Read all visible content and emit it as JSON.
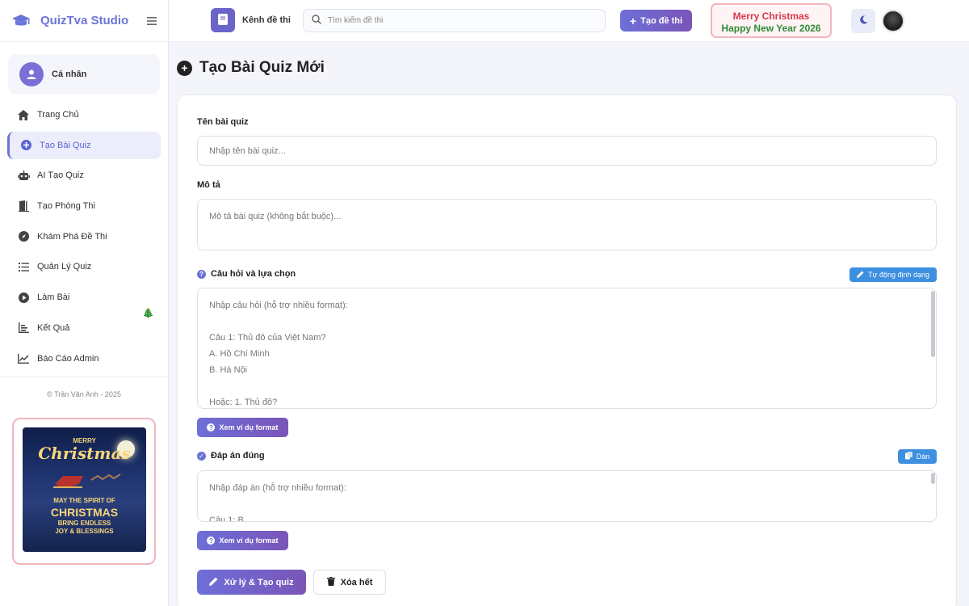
{
  "brand": {
    "name": "QuizTva Studio"
  },
  "sidebar": {
    "profile_label": "Cá nhân",
    "items": [
      {
        "label": "Trang Chủ",
        "icon": "home-icon"
      },
      {
        "label": "Tạo Bài Quiz",
        "icon": "plus-circle-icon",
        "active": true
      },
      {
        "label": "AI Tạo Quiz",
        "icon": "robot-icon"
      },
      {
        "label": "Tạo Phòng Thi",
        "icon": "door-icon"
      },
      {
        "label": "Khám Phá Đề Thi",
        "icon": "compass-icon"
      },
      {
        "label": "Quản Lý Quiz",
        "icon": "list-icon"
      },
      {
        "label": "Làm Bài",
        "icon": "play-icon"
      },
      {
        "label": "Kết Quả",
        "icon": "bar-chart-icon"
      },
      {
        "label": "Báo Cáo   Admin",
        "icon": "line-chart-icon"
      }
    ],
    "copyright": "© Trần Văn Anh - 2025",
    "xmas_card": {
      "line1": "MERRY",
      "line2": "Christmas",
      "line3": "MAY THE SPIRIT OF",
      "line4": "CHRISTMAS",
      "line5": "BRING ENDLESS",
      "line6": "JOY & BLESSINGS"
    }
  },
  "topbar": {
    "channel_label": "Kênh đề thi",
    "search_placeholder": "Tìm kiếm đề thi",
    "create_label": "Tạo đề thi",
    "banner_line1": "Merry Christmas",
    "banner_line2": "Happy New Year 2026"
  },
  "main": {
    "title": "Tạo Bài Quiz Mới",
    "quiz_name_label": "Tên bài quiz",
    "quiz_name_placeholder": "Nhập tên bài quiz...",
    "description_label": "Mô tả",
    "description_placeholder": "Mô tả bài quiz (không bắt buộc)...",
    "questions_label": "Câu hỏi và lựa chọn",
    "auto_format_label": "Tự động định dạng",
    "questions_placeholder": "Nhập câu hỏi (hỗ trợ nhiều format):\n\nCâu 1: Thủ đô của Việt Nam?\nA. Hồ Chí Minh\nB. Hà Nội\n\nHoặc: 1. Thủ đô?",
    "example_format_label": "Xem ví dụ format",
    "answers_label": "Đáp án đúng",
    "paste_label": "Dán",
    "answers_placeholder": "Nhập đáp án (hỗ trợ nhiều format):\n\nCâu 1: B",
    "process_label": "Xử lý & Tạo quiz",
    "clear_label": "Xóa hết"
  },
  "colors": {
    "accent": "#6b74d6",
    "accent_gradient_end": "#7a55b8",
    "info_blue": "#3d8fe0",
    "xmas_red": "#d8384a",
    "xmas_green": "#2f8a36"
  }
}
